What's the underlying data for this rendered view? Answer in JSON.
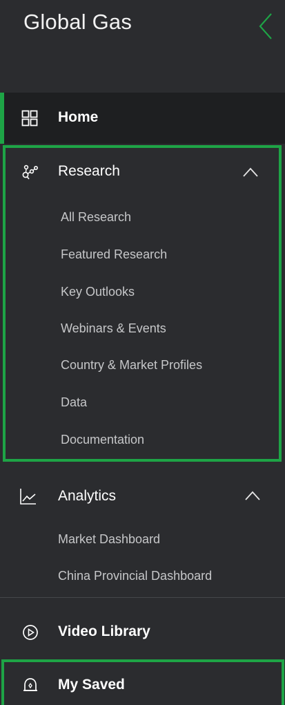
{
  "app": {
    "title": "Global Gas",
    "accent_color": "#1ea446",
    "background_color": "#2b2c2f"
  },
  "header": {
    "collapse_icon": "chevron-left-icon"
  },
  "nav": {
    "home": {
      "label": "Home",
      "icon": "grid-icon",
      "active": true
    },
    "research": {
      "label": "Research",
      "icon": "research-network-icon",
      "expanded": true,
      "items": [
        {
          "label": "All Research"
        },
        {
          "label": "Featured Research"
        },
        {
          "label": "Key Outlooks"
        },
        {
          "label": "Webinars & Events"
        },
        {
          "label": "Country & Market Profiles"
        },
        {
          "label": "Data"
        },
        {
          "label": "Documentation"
        }
      ]
    },
    "analytics": {
      "label": "Analytics",
      "icon": "line-chart-icon",
      "expanded": true,
      "items": [
        {
          "label": "Market Dashboard"
        },
        {
          "label": "China Provincial Dashboard"
        }
      ]
    },
    "video_library": {
      "label": "Video Library",
      "icon": "play-circle-icon"
    },
    "my_saved": {
      "label": "My Saved",
      "icon": "saved-bell-icon"
    }
  }
}
